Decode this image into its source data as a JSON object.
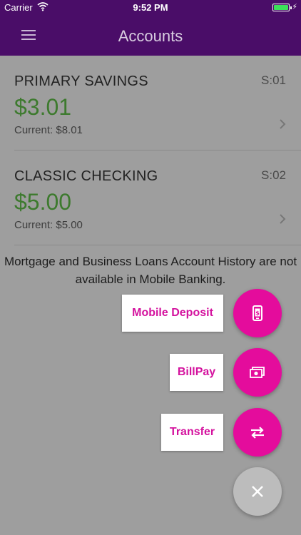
{
  "status_bar": {
    "carrier": "Carrier",
    "time": "9:52 PM"
  },
  "header": {
    "title": "Accounts"
  },
  "accounts": [
    {
      "name": "PRIMARY SAVINGS",
      "code": "S:01",
      "available": "$3.01",
      "current": "Current: $8.01"
    },
    {
      "name": "CLASSIC CHECKING",
      "code": "S:02",
      "available": "$5.00",
      "current": "Current: $5.00"
    }
  ],
  "notice": "Mortgage and Business Loans Account History are not available in Mobile Banking.",
  "fab_menu": {
    "mobile_deposit": "Mobile Deposit",
    "billpay": "BillPay",
    "transfer": "Transfer"
  },
  "colors": {
    "header": "#4a0d68",
    "accent": "#e40c9c",
    "amount": "#3d7a2e",
    "battery": "#3ce05a"
  }
}
